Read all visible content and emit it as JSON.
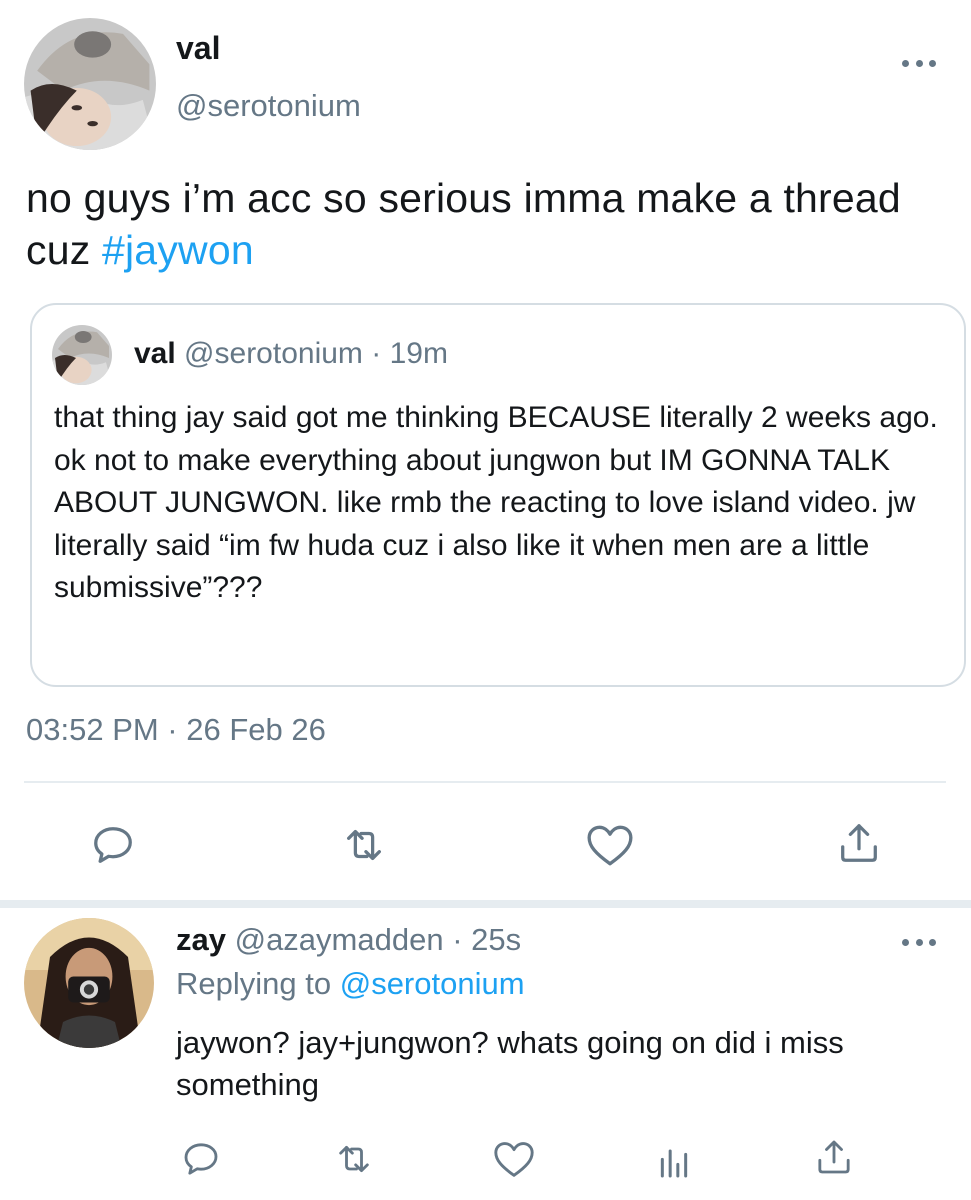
{
  "main_tweet": {
    "author_name": "val",
    "author_handle": "@serotonium",
    "text_before_hashtag": "no guys i’m acc so serious imma make a thread cuz ",
    "hashtag": "#jaywon",
    "timestamp": "03:52 PM · 26 Feb 26",
    "quote": {
      "author_name": "val",
      "meta": " @serotonium · 19m",
      "text": "that thing jay said got me thinking BECAUSE literally 2 weeks ago. ok not to make everything about jungwon but IM GONNA TALK ABOUT JUNGWON. like rmb the reacting to love island video. jw literally said “im fw huda cuz i also like it when men are a little submissive”???"
    },
    "actions": [
      "reply-icon",
      "retweet-icon",
      "like-icon",
      "share-icon"
    ]
  },
  "reply": {
    "author_name": "zay",
    "meta": " @azaymadden · 25s",
    "replying_label": "Replying to ",
    "replying_mention": "@serotonium",
    "text": "jaywon? jay+jungwon? whats going on did i miss something",
    "actions": [
      "reply-icon",
      "retweet-icon",
      "like-icon",
      "analytics-icon",
      "share-icon"
    ]
  },
  "colors": {
    "text": "#14171a",
    "secondary": "#657786",
    "link": "#1da1f2",
    "border": "#d5dde3",
    "divider": "#e6ecf0"
  }
}
